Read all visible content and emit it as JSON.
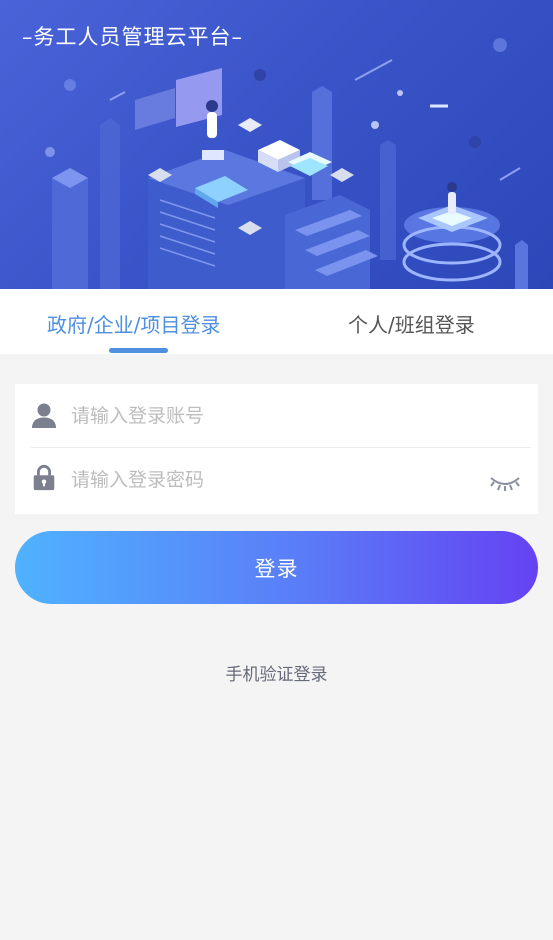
{
  "hero": {
    "title": "–务工人员管理云平台–"
  },
  "tabs": [
    {
      "label": "政府/企业/项目登录",
      "active": true
    },
    {
      "label": "个人/班组登录",
      "active": false
    }
  ],
  "form": {
    "account_placeholder": "请输入登录账号",
    "account_value": "",
    "password_placeholder": "请输入登录密码",
    "password_value": "",
    "user_icon": "user-icon",
    "lock_icon": "lock-icon",
    "eye_icon": "eye-closed-icon"
  },
  "login_button": {
    "label": "登录"
  },
  "sms_login": {
    "label": "手机验证登录"
  },
  "colors": {
    "accent": "#4f8fe0",
    "hero_bg": "#3a55c9",
    "button_start": "#4fb2ff",
    "button_end": "#6542f3",
    "page_bg": "#f4f4f4"
  }
}
